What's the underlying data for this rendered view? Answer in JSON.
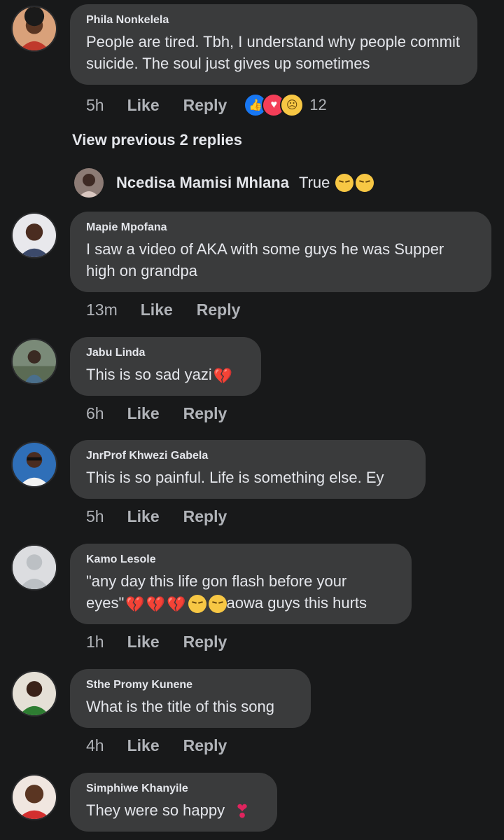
{
  "colors": {
    "background": "#18191a",
    "bubble": "#3a3b3c",
    "text": "#e4e6eb",
    "muted": "#b0b3b8"
  },
  "comments": [
    {
      "author": "Phila Nonkelela",
      "text": "People are tired. Tbh, I understand why people commit suicide. The soul just gives up sometimes",
      "time": "5h",
      "like": "Like",
      "reply": "Reply",
      "reaction_count": "12",
      "reactions": [
        "like-icon",
        "love-icon",
        "sad-icon"
      ]
    },
    {
      "author": "Mapie Mpofana",
      "text": "I saw a video of AKA with some guys he was Supper high on grandpa",
      "time": "13m",
      "like": "Like",
      "reply": "Reply"
    },
    {
      "author": "Jabu Linda",
      "text": "This is so sad yazi",
      "time": "6h",
      "like": "Like",
      "reply": "Reply"
    },
    {
      "author": "JnrProf Khwezi Gabela",
      "text": "This is so painful. Life is something else. Ey",
      "time": "5h",
      "like": "Like",
      "reply": "Reply"
    },
    {
      "author": "Kamo Lesole",
      "text_line1": "\"any day this life gon flash before your",
      "text_line2a": "eyes\"",
      "text_line2b": "aowa guys this hurts",
      "time": "1h",
      "like": "Like",
      "reply": "Reply"
    },
    {
      "author": "Sthe Promy Kunene",
      "text": "What is the title of this song",
      "time": "4h",
      "like": "Like",
      "reply": "Reply"
    },
    {
      "author": "Simphiwe Khanyile",
      "text": "They were so happy"
    }
  ],
  "view_previous": "View previous 2 replies",
  "reply": {
    "author": "Ncedisa Mamisi Mhlana",
    "text": "True"
  }
}
